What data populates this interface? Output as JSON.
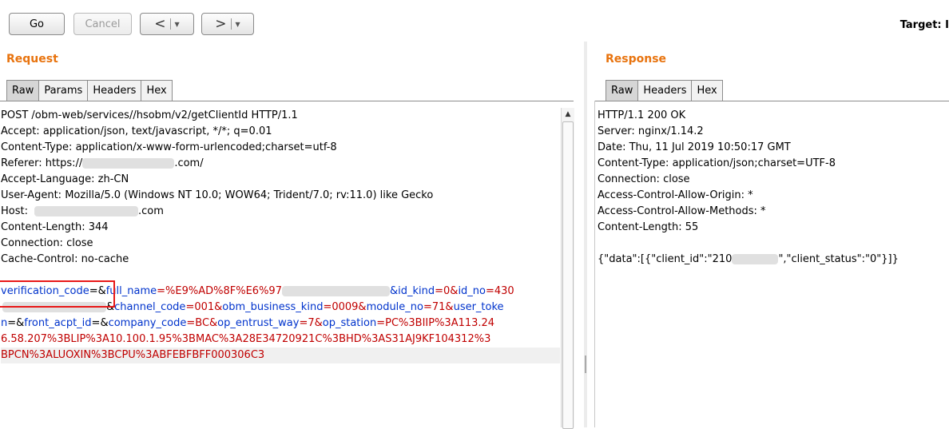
{
  "toolbar": {
    "go_label": "Go",
    "cancel_label": "Cancel",
    "back_arrow": "<",
    "forward_arrow": ">",
    "dropdown_glyph": "▼",
    "target_label": "Target: I"
  },
  "request": {
    "title": "Request",
    "tabs": [
      "Raw",
      "Params",
      "Headers",
      "Hex"
    ],
    "active_tab": "Raw",
    "lines": {
      "l1": "POST /obm-web/services//hsobm/v2/getClientId HTTP/1.1",
      "l2": "Accept: application/json, text/javascript, */*; q=0.01",
      "l3": "Content-Type: application/x-www-form-urlencoded;charset=utf-8",
      "l4a": "Referer: https://",
      "l4b": ".com/",
      "l5": "Accept-Language: zh-CN",
      "l6": "User-Agent: Mozilla/5.0 (Windows NT 10.0; WOW64; Trident/7.0; rv:11.0) like Gecko",
      "l7a": "Host:",
      "l7b": ".com",
      "l8": "Content-Length: 344",
      "l9": "Connection: close",
      "l10": "Cache-Control: no-cache"
    },
    "body": {
      "b1_name1": "verification_code",
      "b1_eq1": "=&",
      "b1_name2": "full_name",
      "b1_val2": "=%E9%AD%8F%E6%97",
      "b1_tail1": "&id_kind",
      "b1_tail2": "=0&",
      "b1_tail3": "id_no",
      "b1_tail4": "=430",
      "b2_a": "&",
      "b2_name1": "channel_code",
      "b2_val1": "=001&",
      "b2_name2": "obm_business_kind",
      "b2_val2": "=0009&",
      "b2_name3": "module_no",
      "b2_val3": "=71&",
      "b2_name4": "user_toke",
      "b3_name0": "n",
      "b3_val0": "=&",
      "b3_name1": "front_acpt_id",
      "b3_val1": "=&",
      "b3_name2": "company_code",
      "b3_val2": "=BC&",
      "b3_name3": "op_entrust_way",
      "b3_val3": "=7&",
      "b3_name4": "op_station",
      "b3_val4": "=PC%3BIIP%3A113.24",
      "b4": "6.58.207%3BLIP%3A10.100.1.95%3BMAC%3A28E34720921C%3BHD%3AS31AJ9KF104312%3",
      "b5": "BPCN%3ALUOXIN%3BCPU%3ABFEBFBFF000306C3"
    }
  },
  "response": {
    "title": "Response",
    "tabs": [
      "Raw",
      "Headers",
      "Hex"
    ],
    "active_tab": "Raw",
    "lines": {
      "r1": "HTTP/1.1 200 OK",
      "r2": "Server: nginx/1.14.2",
      "r3": "Date: Thu, 11 Jul 2019 10:50:17 GMT",
      "r4": "Content-Type: application/json;charset=UTF-8",
      "r5": "Connection: close",
      "r6": "Access-Control-Allow-Origin: *",
      "r7": "Access-Control-Allow-Methods: *",
      "r8": "Content-Length: 55",
      "r9a": "{\"data\":[{\"client_id\":\"210",
      "r9b": "\",\"client_status\":\"0\"}]}"
    }
  },
  "icons": {
    "scroll_up": "▲"
  }
}
